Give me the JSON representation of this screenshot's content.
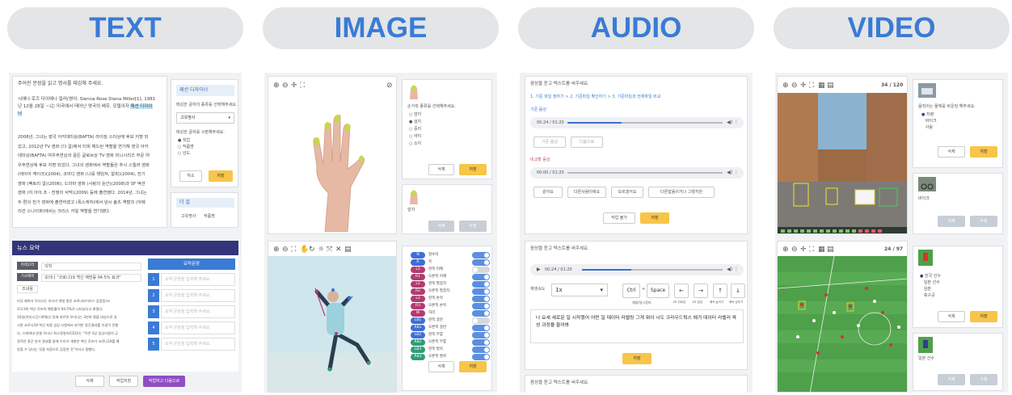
{
  "pills": {
    "text": "TEXT",
    "image": "IMAGE",
    "audio": "AUDIO",
    "video": "VIDEO"
  },
  "text_panel": {
    "instruction": "주어진 문장을 읽고 명사를 태깅해 주세요.",
    "paragraph1a": "시에나 로즈 다이애나 밀러(영어: Sienna Rose Diana Miller[1], 1981",
    "paragraph1b": "년 12월 28일 ~)는 미국에서 태어난 영국의 배우, 모델이자",
    "highlight_designer": "패션 디자이",
    "paragraph1c": "너",
    "paragraph2": [
      "2008년, 그녀는 영국 아카데미상(BAFTA) 라이징 스타상에 후보 지명 되",
      "었고, 2012년 TV 영화 (더 걸)에서 티피 헤드런 역할을 연기해 영국 아카",
      "데미상(BAFTA) 여우주연상과 골든 글로브상 TV 영화 미니시리즈 부문 여",
      "우주연상에 후보 지명 되었다. 그녀의 영화에서 역할들은 추시 스릴러 영화",
      "(레이어 케이크)(2004), 코미디 영화 (나를 책임져, 알피)(2004), 전기",
      "영화 (팩토리 걸)(2006), 드라마 영화 (사랑의 순간)(2008)과 SF 액션",
      "영화 (지.아이.조 - 전쟁의 서막)(2009) 등에 출연했다. 2014년, 그녀는",
      "두 편의 전기 영화에 출연하였고 (폭스캐처)에서 낸시 슐츠 역할과 (아메",
      "리칸 스나이퍼)에서는 크리스 카일 역할을 연기했다."
    ],
    "tag_title": "패션 디자이너",
    "q1": "태깅한 글자의 종류를 선택해주세요.",
    "select1": "고유명사",
    "q2": "태깅한 글자를 구분해주세요.",
    "options": [
      "직업",
      "작품명",
      "년도"
    ],
    "cancel": "취소",
    "save": "저장",
    "more_title": "더 걸",
    "more_tags": [
      "고유명사",
      "작품명"
    ]
  },
  "news_panel": {
    "title": "뉴스 요약",
    "category_label": "카테고리",
    "category_value": "의학",
    "headline_label": "기사제목",
    "headline_value": "모더나 \"코로나19 백신 예방률 94.5% 효과\"",
    "body_label": "조내용",
    "body": [
      "미국 제약사 모더나는 자사가 개발 중인 코로나바이러스 감염증(코",
      "로나19) 백신 후보의 예방률이 94.5%로 나타났다고 밝혔다.",
      "16일(현지시간) AP통신 등에 따르면 모더나는 3만여 명을 대상으로 실",
      "시한 코로나19 백신 최종 임상 시험에서 분석한 중간결과를 이같이 전했",
      "다. 스테파네 방셀 모더나 최고경영자(CEO)는 \"이번 3상 임상시험의 긍",
      "정적인 중간 분석 결과를 통해 우리가 개발한 백신 후보가 코로나19를 예",
      "방할 수 있다는 것을 처음으로 검증한 것\"이라고 말했다."
    ],
    "summary_title": "요약문장",
    "rows": [
      "1",
      "2",
      "3",
      "4",
      "5"
    ],
    "placeholder": "요약 문장을 입력해 주세요.",
    "btn_delete": "삭제",
    "btn_save": "작업저장",
    "btn_download": "작업하고 다음으로"
  },
  "image_panel": {
    "q": "손가락 종류를 선택해주세요.",
    "options": [
      "엄지",
      "검지",
      "중지",
      "약지",
      "소지"
    ],
    "delete": "삭제",
    "save": "저장",
    "thumb_label": "엄지",
    "tags": [
      {
        "code": "N",
        "label": "정수리",
        "color": "#3f6fd6"
      },
      {
        "code": "R",
        "label": "목",
        "color": "#3f6fd6"
      },
      {
        "code": "L1",
        "label": "왼쪽 어깨",
        "color": "#b23c70",
        "off": true
      },
      {
        "code": "R1",
        "label": "오른쪽 어깨",
        "color": "#b23c70"
      },
      {
        "code": "L2",
        "label": "왼쪽 팔꿈치",
        "color": "#b23c70"
      },
      {
        "code": "R2",
        "label": "오른쪽 팔꿈치",
        "color": "#b23c70"
      },
      {
        "code": "L3",
        "label": "왼쪽 손목",
        "color": "#b23c70"
      },
      {
        "code": "R3",
        "label": "오른쪽 손목",
        "color": "#b23c70"
      },
      {
        "code": "W",
        "label": "허리",
        "color": "#b23c70"
      },
      {
        "code": "LB1",
        "label": "왼쪽 골반",
        "color": "#3f6fd6",
        "off": true
      },
      {
        "code": "RB1",
        "label": "오른쪽 골반",
        "color": "#3f6fd6"
      },
      {
        "code": "LB2",
        "label": "왼쪽 무릎",
        "color": "#3f6fd6"
      },
      {
        "code": "RB2",
        "label": "오른쪽 무릎",
        "color": "#2f9e75"
      },
      {
        "code": "LB3",
        "label": "왼쪽 발목",
        "color": "#2f9e75"
      },
      {
        "code": "RB3",
        "label": "오른쪽 발목",
        "color": "#2f9e75"
      }
    ],
    "tog_on": "사용",
    "tog_off": "미사용"
  },
  "audio_panel": {
    "q": "음성을 듣고 텍스트를 써주세요.",
    "steps": "1. 기준 파일 정하기 > 2. 기준파일 확인하기 > 3. 기준파일과 전체파일 비교",
    "label_ref": "기준 음성",
    "time1": "00:24 / 01:20",
    "btn_a": "기준 음성",
    "btn_b": "다음으로",
    "label_cmp": "비교할 음성",
    "time2": "00:00 / 01:20",
    "choices": [
      "같아요",
      "다른사람이에요",
      "모르겠어요",
      "다른잡음이거나 그렇지만"
    ],
    "btn_skip": "작업 불가",
    "btn_save": "저장",
    "q2": "음성을 듣고 텍스트를 써주세요.",
    "time3": "00:24 / 01:20",
    "speed_label": "재생속도",
    "speed": "1x",
    "keys": [
      "Ctrl",
      "Space",
      "←",
      "→",
      "↑",
      "↓"
    ],
    "key_hint": "재생/일시정지",
    "key_hints": [
      "1초 뒤로감",
      "1초 앞감",
      "배속 높이기",
      "배속 낮추기"
    ],
    "transcript": "나 요새 새로운 일 시작했어 어떤 일 데이터 라벨링 그게 뭐야 너도 크라우드웍스 에가 데이터 라벨러 육성 과정을 들어봐",
    "btn_save2": "저장",
    "q3": "음성을 듣고 텍스트를 써주세요."
  },
  "video_panel": {
    "counter1": "34 / 120",
    "q": "움직이는 물체를 바운딩 해주세요.",
    "opts1": [
      "차량",
      "바이크",
      "사람"
    ],
    "delete": "삭제",
    "save": "저장",
    "thumb1": "바이크",
    "btn_disabled1": "삭제",
    "btn_disabled2": "수정",
    "counter2": "24 / 97",
    "opts2": [
      "한국 선수",
      "일본 선수",
      "심판",
      "축구공"
    ],
    "thumb2": "일본 선수"
  }
}
